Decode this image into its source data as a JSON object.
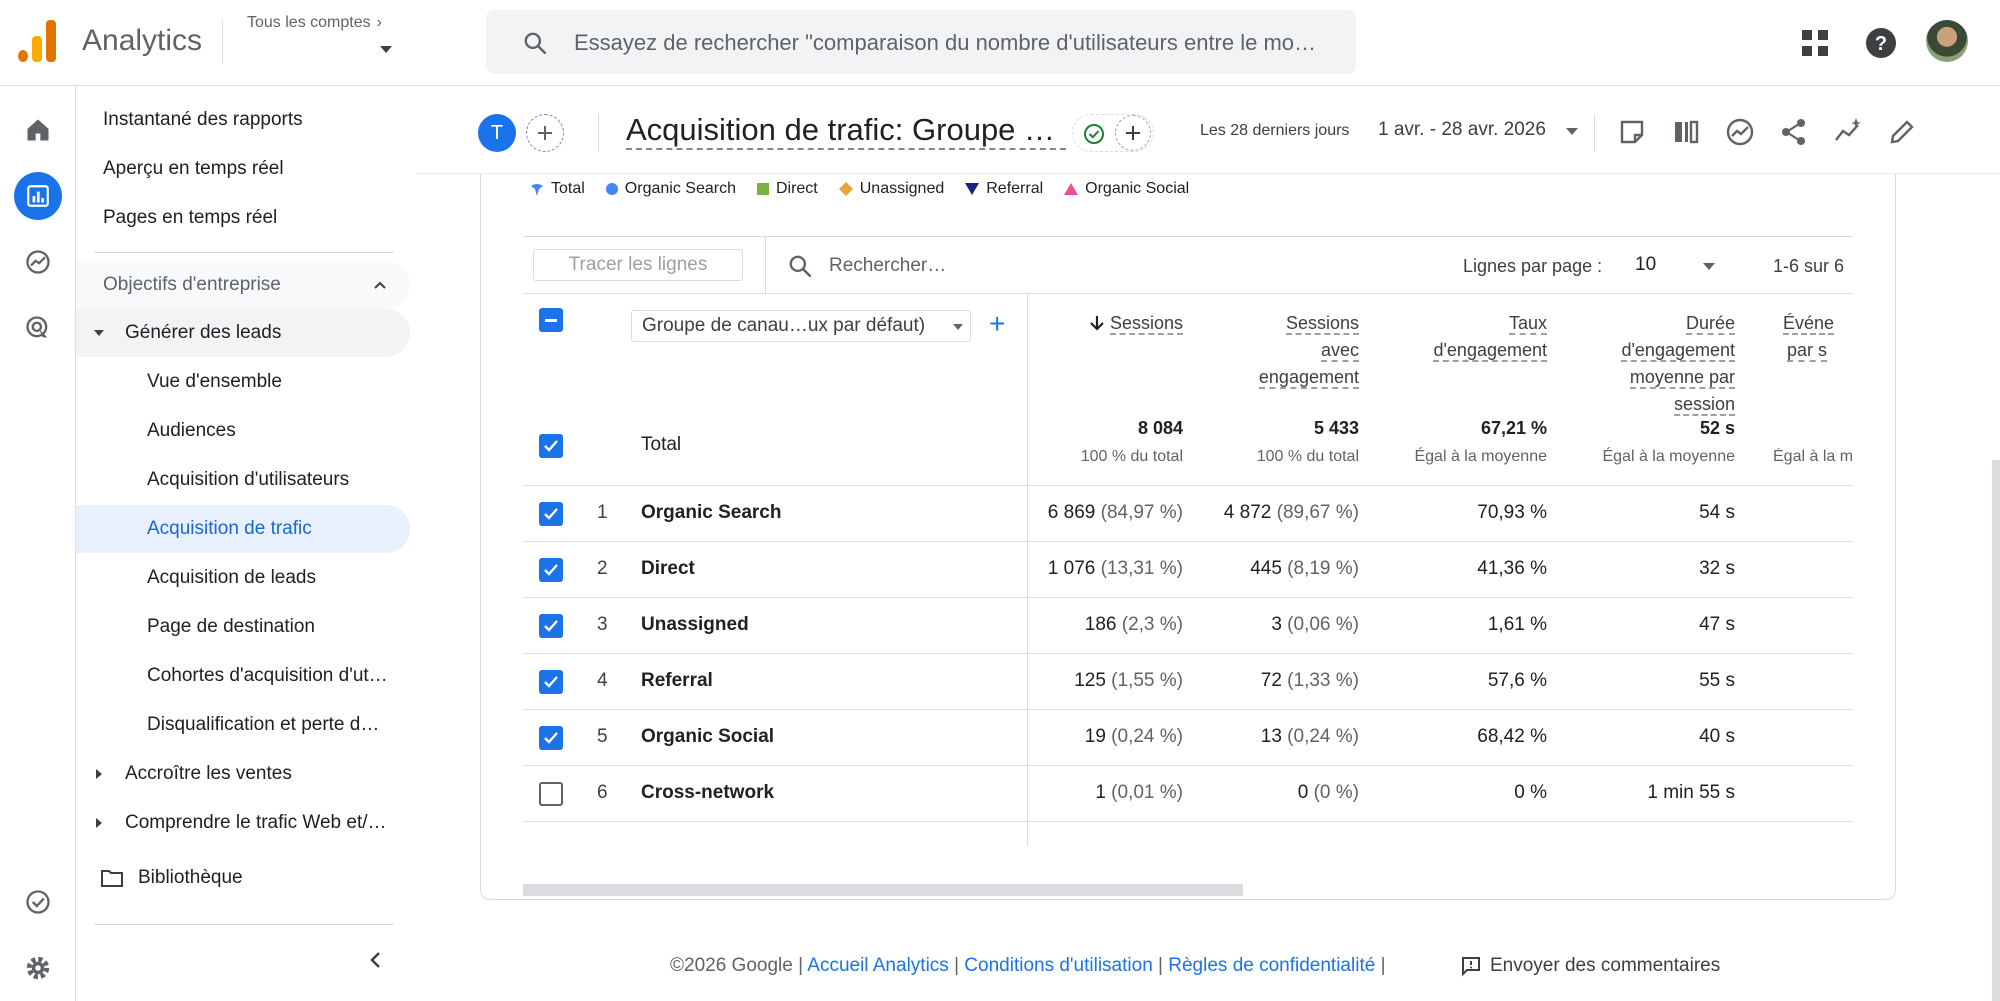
{
  "header": {
    "app_name": "Analytics",
    "account_label": "Tous les comptes",
    "search_placeholder": "Essayez de rechercher \"comparaison du nombre d'utilisateurs entre le mo…",
    "icons": [
      "apps-grid-icon",
      "help-icon",
      "avatar"
    ]
  },
  "rail": {
    "icons": [
      "home-icon",
      "reports-icon",
      "explore-icon",
      "advertising-icon",
      "tasks-icon",
      "settings-icon"
    ],
    "active": "reports-icon"
  },
  "nav": {
    "items": [
      {
        "label": "Instantané des rapports"
      },
      {
        "label": "Aperçu en temps réel"
      },
      {
        "label": "Pages en temps réel"
      }
    ],
    "section_label": "Objectifs d'entreprise",
    "group_label": "Générer des leads",
    "sub_items": [
      {
        "label": "Vue d'ensemble"
      },
      {
        "label": "Audiences"
      },
      {
        "label": "Acquisition d'utilisateurs"
      },
      {
        "label": "Acquisition de trafic"
      },
      {
        "label": "Acquisition de leads"
      },
      {
        "label": "Page de destination"
      },
      {
        "label": "Cohortes d'acquisition d'ut…"
      },
      {
        "label": "Disqualification et perte d…"
      }
    ],
    "collapsed_groups": [
      {
        "label": "Accroître les ventes"
      },
      {
        "label": "Comprendre le trafic Web et/…"
      }
    ],
    "library_label": "Bibliothèque"
  },
  "report": {
    "avatar_letter": "T",
    "title": "Acquisition de trafic: Groupe d…",
    "date_label": "Les 28 derniers jours",
    "date_range": "1 avr. - 28 avr. 2026"
  },
  "legend": [
    {
      "label": "Total",
      "color": "#4285f4",
      "shape": "pin"
    },
    {
      "label": "Organic Search",
      "color": "#4285f4",
      "shape": "circle"
    },
    {
      "label": "Direct",
      "color": "#7cb342",
      "shape": "square"
    },
    {
      "label": "Unassigned",
      "color": "#e8a33d",
      "shape": "diamond"
    },
    {
      "label": "Referral",
      "color": "#1a237e",
      "shape": "triangle-down"
    },
    {
      "label": "Organic Social",
      "color": "#e94f9b",
      "shape": "triangle-up"
    }
  ],
  "table": {
    "trace_button": "Tracer les lignes",
    "search_placeholder": "Rechercher…",
    "rows_per_page_label": "Lignes par page :",
    "rows_per_page_value": "10",
    "pager": "1-6 sur 6",
    "dimension_select": "Groupe de canau…ux par défaut)",
    "columns": [
      {
        "lines": [
          "Sessions"
        ],
        "sorted": true
      },
      {
        "lines": [
          "Sessions",
          "avec",
          "engagement"
        ]
      },
      {
        "lines": [
          "Taux",
          "d'engagement"
        ]
      },
      {
        "lines": [
          "Durée",
          "d'engagement",
          "moyenne par",
          "session"
        ]
      },
      {
        "lines": [
          "Événe",
          "par s"
        ]
      }
    ],
    "total": {
      "label": "Total",
      "values": [
        "8 084",
        "5 433",
        "67,21 %",
        "52 s"
      ],
      "subs": [
        "100 % du total",
        "100 % du total",
        "Égal à la moyenne",
        "Égal à la moyenne",
        "Égal à la m"
      ]
    },
    "rows": [
      {
        "n": "1",
        "label": "Organic Search",
        "checked": true,
        "v": [
          [
            "6 869",
            " (84,97 %)"
          ],
          [
            "4 872",
            " (89,67 %)"
          ],
          [
            "70,93 %",
            ""
          ],
          [
            "54 s",
            ""
          ]
        ]
      },
      {
        "n": "2",
        "label": "Direct",
        "checked": true,
        "v": [
          [
            "1 076",
            " (13,31 %)"
          ],
          [
            "445",
            " (8,19 %)"
          ],
          [
            "41,36 %",
            ""
          ],
          [
            "32 s",
            ""
          ]
        ]
      },
      {
        "n": "3",
        "label": "Unassigned",
        "checked": true,
        "v": [
          [
            "186",
            " (2,3 %)"
          ],
          [
            "3",
            " (0,06 %)"
          ],
          [
            "1,61 %",
            ""
          ],
          [
            "47 s",
            ""
          ]
        ]
      },
      {
        "n": "4",
        "label": "Referral",
        "checked": true,
        "v": [
          [
            "125",
            " (1,55 %)"
          ],
          [
            "72",
            " (1,33 %)"
          ],
          [
            "57,6 %",
            ""
          ],
          [
            "55 s",
            ""
          ]
        ]
      },
      {
        "n": "5",
        "label": "Organic Social",
        "checked": true,
        "v": [
          [
            "19",
            " (0,24 %)"
          ],
          [
            "13",
            " (0,24 %)"
          ],
          [
            "68,42 %",
            ""
          ],
          [
            "40 s",
            ""
          ]
        ]
      },
      {
        "n": "6",
        "label": "Cross-network",
        "checked": false,
        "v": [
          [
            "1",
            " (0,01 %)"
          ],
          [
            "0",
            " (0 %)"
          ],
          [
            "0 %",
            ""
          ],
          [
            "1 min 55 s",
            ""
          ]
        ]
      }
    ]
  },
  "footer": {
    "copyright": "©2026 Google",
    "sep": " | ",
    "links": [
      "Accueil Analytics",
      "Conditions d'utilisation",
      "Règles de confidentialité"
    ],
    "feedback": "Envoyer des commentaires"
  }
}
